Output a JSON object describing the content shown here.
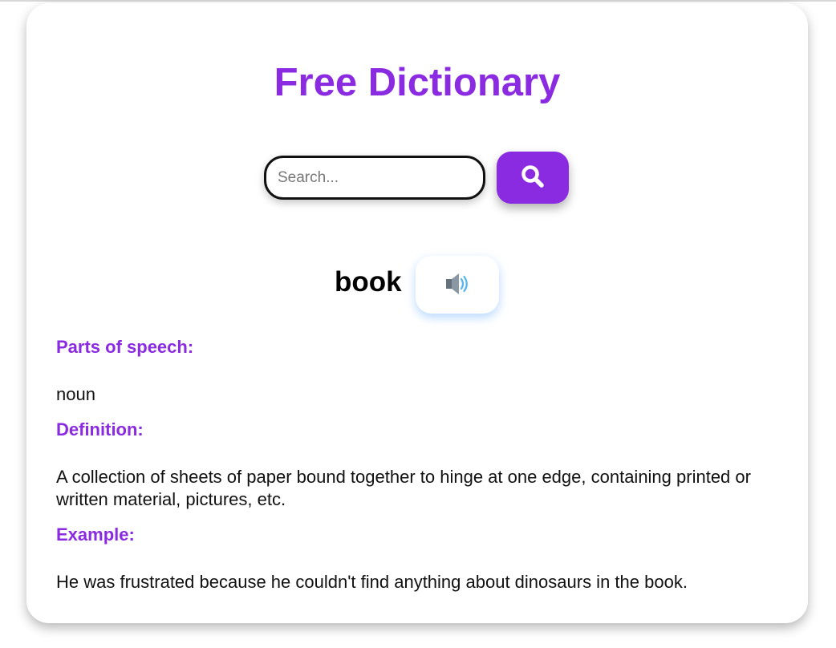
{
  "app": {
    "title": "Free Dictionary"
  },
  "search": {
    "placeholder": "Search...",
    "value": "",
    "button_icon": "search-icon"
  },
  "entry": {
    "word": "book",
    "audio_icon": "speaker-icon",
    "parts_of_speech_label": "Parts of speech:",
    "parts_of_speech_value": "noun",
    "definition_label": "Definition:",
    "definition_value": "A collection of sheets of paper bound together to hinge at one edge, containing printed or written material, pictures, etc.",
    "example_label": "Example:",
    "example_value": "He was frustrated because he couldn't find anything about dinosaurs in the book."
  },
  "colors": {
    "accent": "#8a2be2",
    "text": "#111111",
    "card_background": "#ffffff"
  }
}
